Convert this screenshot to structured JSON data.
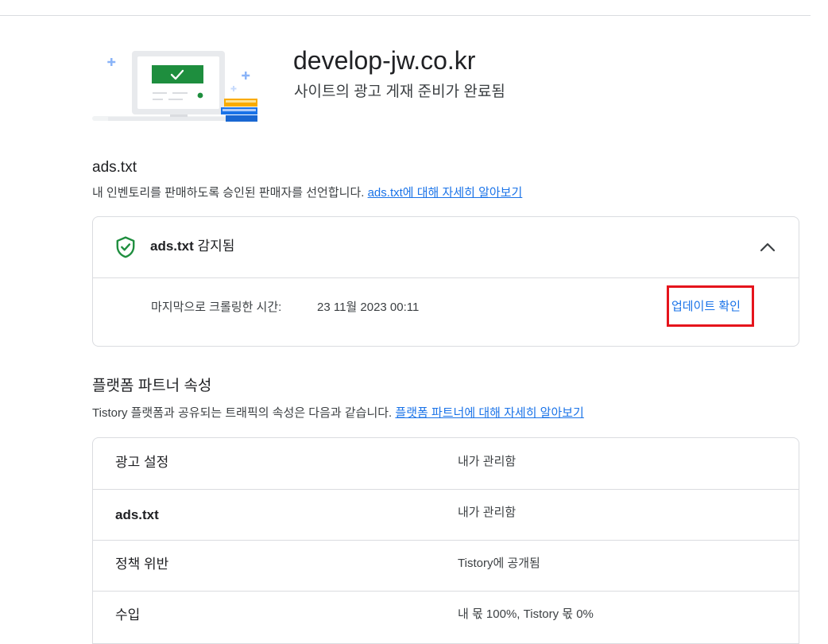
{
  "header": {
    "site_name": "develop-jw.co.kr",
    "status": "사이트의 광고 게재 준비가 완료됨"
  },
  "ads_txt": {
    "heading": "ads.txt",
    "description": "내 인벤토리를 판매하도록 승인된 판매자를 선언합니다.",
    "learn_more": "ads.txt에 대해 자세히 알아보기",
    "status_bold": "ads.txt",
    "status_text": " 감지됨",
    "crawl_label": "마지막으로 크롤링한 시간:",
    "crawl_value": "23 11월 2023 00:11",
    "update_link": "업데이트 확인"
  },
  "platform_partner": {
    "heading": "플랫폼 파트너 속성",
    "description": "Tistory 플랫폼과 공유되는 트래픽의 속성은 다음과 같습니다.",
    "learn_more": "플랫폼 파트너에 대해 자세히 알아보기",
    "rows": [
      {
        "label": "광고 설정",
        "value": "내가 관리함"
      },
      {
        "label": "ads.txt",
        "value": "내가 관리함"
      },
      {
        "label": "정책 위반",
        "value": "Tistory에 공개됨"
      },
      {
        "label": "수입",
        "value": "내 몫 100%, Tistory 몫 0%"
      }
    ]
  },
  "colors": {
    "accent": "#1a73e8",
    "success": "#1e8e3e",
    "highlight": "#e5141c"
  },
  "icons": {
    "hero": "site-ready-illustration",
    "status": "shield-check-icon",
    "toggle": "chevron-up-icon"
  }
}
